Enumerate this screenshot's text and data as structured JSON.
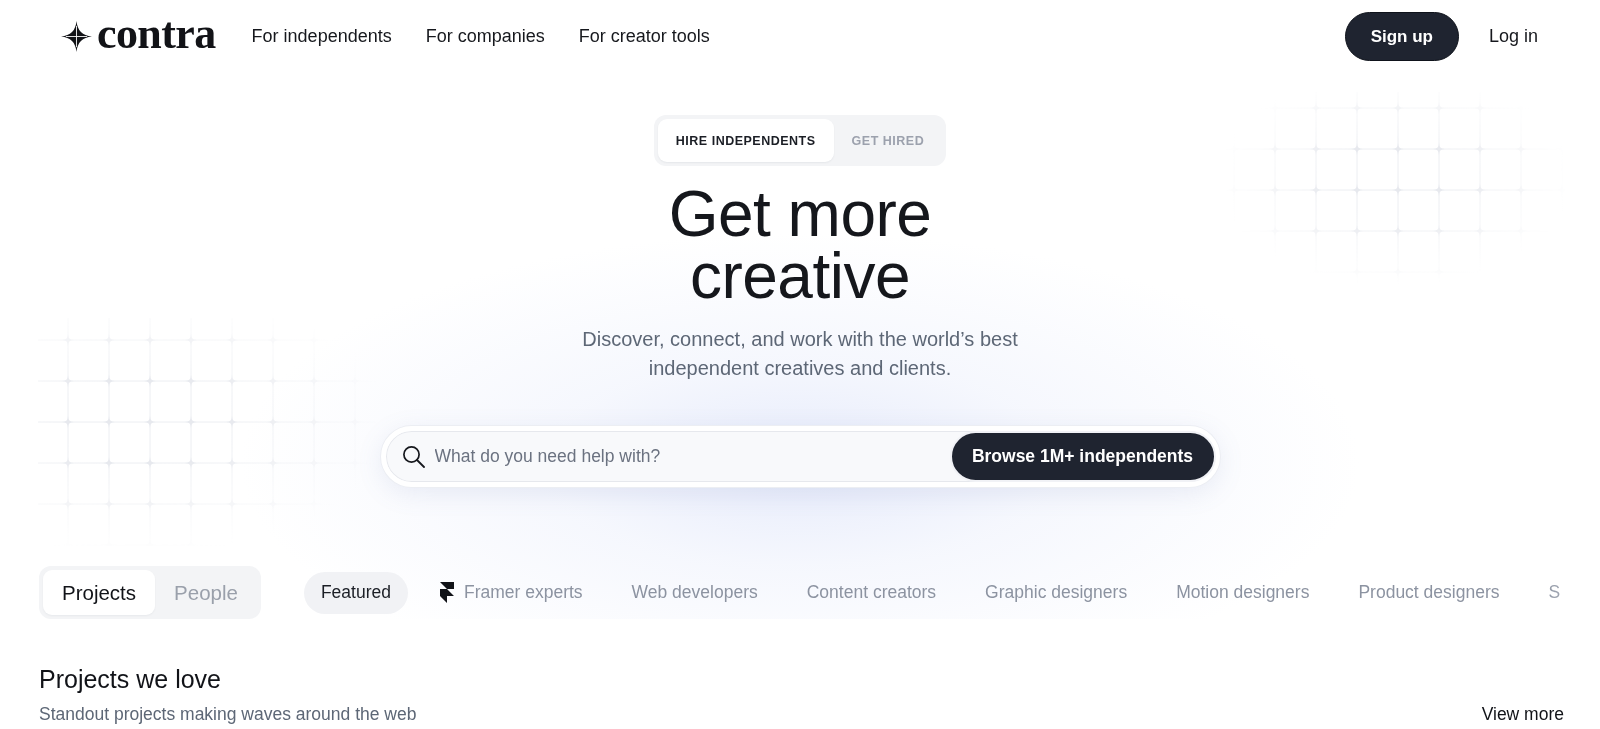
{
  "header": {
    "logo": "contra",
    "nav": [
      "For independents",
      "For companies",
      "For creator tools"
    ],
    "actions": [
      {
        "label": "Sign up",
        "kind": "primary"
      },
      {
        "label": "Log in",
        "kind": "link"
      }
    ]
  },
  "hero": {
    "mode_tabs": [
      {
        "label": "HIRE INDEPENDENTS",
        "selected": true
      },
      {
        "label": "GET HIRED",
        "selected": false
      }
    ],
    "title": "Get more creative",
    "subtitle": "Discover, connect, and work with the world’s best independent creatives and clients.",
    "search": {
      "placeholder": "What do you need help with?",
      "button": "Browse 1M+ independents"
    }
  },
  "browse": {
    "view_tabs": [
      {
        "label": "Projects",
        "selected": true
      },
      {
        "label": "People",
        "selected": false
      }
    ],
    "categories": [
      {
        "label": "Featured",
        "kind": "text",
        "selected": true
      },
      {
        "label": "Framer experts",
        "kind": "icon",
        "selected": false
      },
      {
        "label": "Web developers",
        "kind": "text",
        "selected": false
      },
      {
        "label": "Content creators",
        "kind": "text",
        "selected": false
      },
      {
        "label": "Graphic designers",
        "kind": "text",
        "selected": false
      },
      {
        "label": "Motion designers",
        "kind": "text",
        "selected": false
      },
      {
        "label": "Product designers",
        "kind": "text",
        "selected": false
      },
      {
        "label": "S",
        "kind": "text",
        "selected": false
      }
    ]
  },
  "section": {
    "title": "Projects we love",
    "subtitle": "Standout projects making waves around the web",
    "link": "View more"
  }
}
